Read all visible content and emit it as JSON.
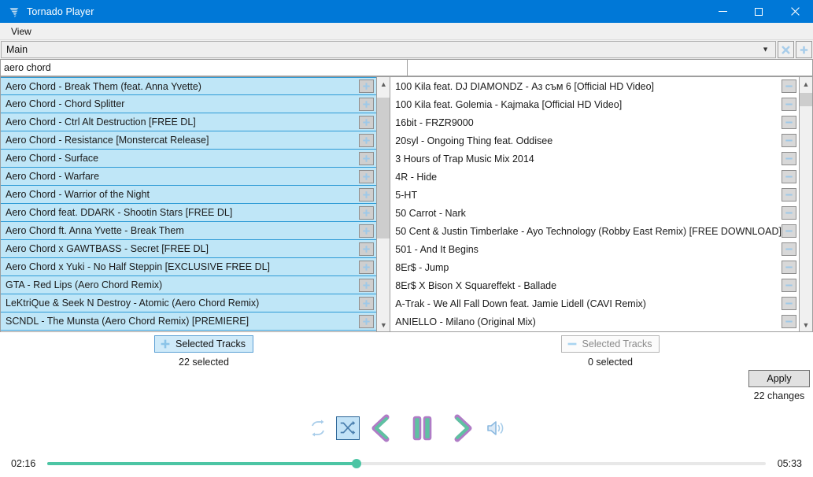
{
  "window": {
    "title": "Tornado Player",
    "app_icon": "tornado-icon",
    "accent": "#0078d7",
    "controls": {
      "minimize": "minimize-icon",
      "maximize": "maximize-icon",
      "close": "close-icon"
    }
  },
  "menubar": {
    "items": [
      {
        "label": "View"
      }
    ]
  },
  "playlist_selector": {
    "value": "Main",
    "arrow": "chevron-down-icon",
    "remove_button": {
      "icon": "x-icon",
      "label": ""
    },
    "add_button": {
      "icon": "plus-icon",
      "label": ""
    }
  },
  "search": {
    "left": {
      "value": "aero chord",
      "placeholder": ""
    },
    "right": {
      "value": "",
      "placeholder": ""
    }
  },
  "left_panel": {
    "item_button_icon": "plus-icon",
    "scrollbar": {
      "up": "chevron-up-icon",
      "down": "chevron-down-icon",
      "thumb_top_pct": 3,
      "thumb_height_pct": 62
    },
    "items": [
      {
        "label": "Aero Chord - Break Them (feat. Anna Yvette)",
        "selected": true
      },
      {
        "label": "Aero Chord - Chord Splitter",
        "selected": true
      },
      {
        "label": "Aero Chord - Ctrl Alt Destruction [FREE DL]",
        "selected": true
      },
      {
        "label": "Aero Chord - Resistance [Monstercat Release]",
        "selected": true
      },
      {
        "label": "Aero Chord - Surface",
        "selected": true
      },
      {
        "label": "Aero Chord - Warfare",
        "selected": true
      },
      {
        "label": "Aero Chord - Warrior of the Night",
        "selected": true
      },
      {
        "label": "Aero Chord feat. DDARK - Shootin Stars [FREE DL]",
        "selected": true
      },
      {
        "label": "Aero Chord ft. Anna Yvette - Break Them",
        "selected": true
      },
      {
        "label": "Aero Chord x GAWTBASS - Secret [FREE DL]",
        "selected": true
      },
      {
        "label": "Aero Chord x Yuki - No Half Steppin [EXCLUSIVE FREE DL]",
        "selected": true
      },
      {
        "label": "GTA - Red Lips (Aero Chord Remix)",
        "selected": true
      },
      {
        "label": "LeKtriQue & Seek N Destroy - Atomic (Aero Chord Remix)",
        "selected": true
      },
      {
        "label": "SCNDL - The Munsta (Aero Chord Remix) [PREMIERE]",
        "selected": true
      }
    ],
    "action": {
      "button_label": "Selected Tracks",
      "button_icon": "plus-icon",
      "disabled": false,
      "count_label": "22 selected"
    }
  },
  "right_panel": {
    "item_button_icon": "minus-icon",
    "scrollbar": {
      "up": "chevron-up-icon",
      "down": "chevron-down-icon",
      "thumb_top_pct": 1,
      "thumb_height_pct": 6
    },
    "items": [
      {
        "label": "100 Kila feat. DJ DIAMONDZ - Аз съм 6 [Official HD Video]",
        "selected": false
      },
      {
        "label": "100 Kila feat. Golemia - Kajmaka [Official HD Video]",
        "selected": false
      },
      {
        "label": "16bit - FRZR9000",
        "selected": false
      },
      {
        "label": "20syl - Ongoing Thing feat. Oddisee",
        "selected": false
      },
      {
        "label": "3 Hours of Trap Music Mix 2014",
        "selected": false
      },
      {
        "label": "4R - Hide",
        "selected": false
      },
      {
        "label": "5-HT",
        "selected": false
      },
      {
        "label": "50 Carrot - Nark",
        "selected": false
      },
      {
        "label": "50 Cent & Justin Timberlake - Ayo Technology (Robby East Remix) [FREE DOWNLOAD]",
        "selected": false
      },
      {
        "label": "501 - And It Begins",
        "selected": false
      },
      {
        "label": "8Er$ - Jump",
        "selected": false
      },
      {
        "label": "8Er$ X Bison X Squareffekt - Ballade",
        "selected": false
      },
      {
        "label": "A-Trak - We All Fall Down feat. Jamie Lidell (CAVI Remix)",
        "selected": false
      },
      {
        "label": "ANIELLO - Milano (Original Mix)",
        "selected": false
      }
    ],
    "action": {
      "button_label": "Selected Tracks",
      "button_icon": "minus-icon",
      "disabled": true,
      "count_label": "0 selected"
    }
  },
  "apply": {
    "label": "Apply",
    "note": "22 changes"
  },
  "transport": {
    "repeat": {
      "icon": "repeat-icon",
      "active": false
    },
    "shuffle": {
      "icon": "shuffle-icon",
      "active": true
    },
    "previous": {
      "icon": "previous-icon"
    },
    "pause": {
      "icon": "pause-icon"
    },
    "next": {
      "icon": "next-icon"
    },
    "volume": {
      "icon": "volume-icon"
    }
  },
  "seek": {
    "elapsed": "02:16",
    "total": "05:33",
    "progress_pct": 43,
    "fill_color": "#4cc5a4"
  }
}
